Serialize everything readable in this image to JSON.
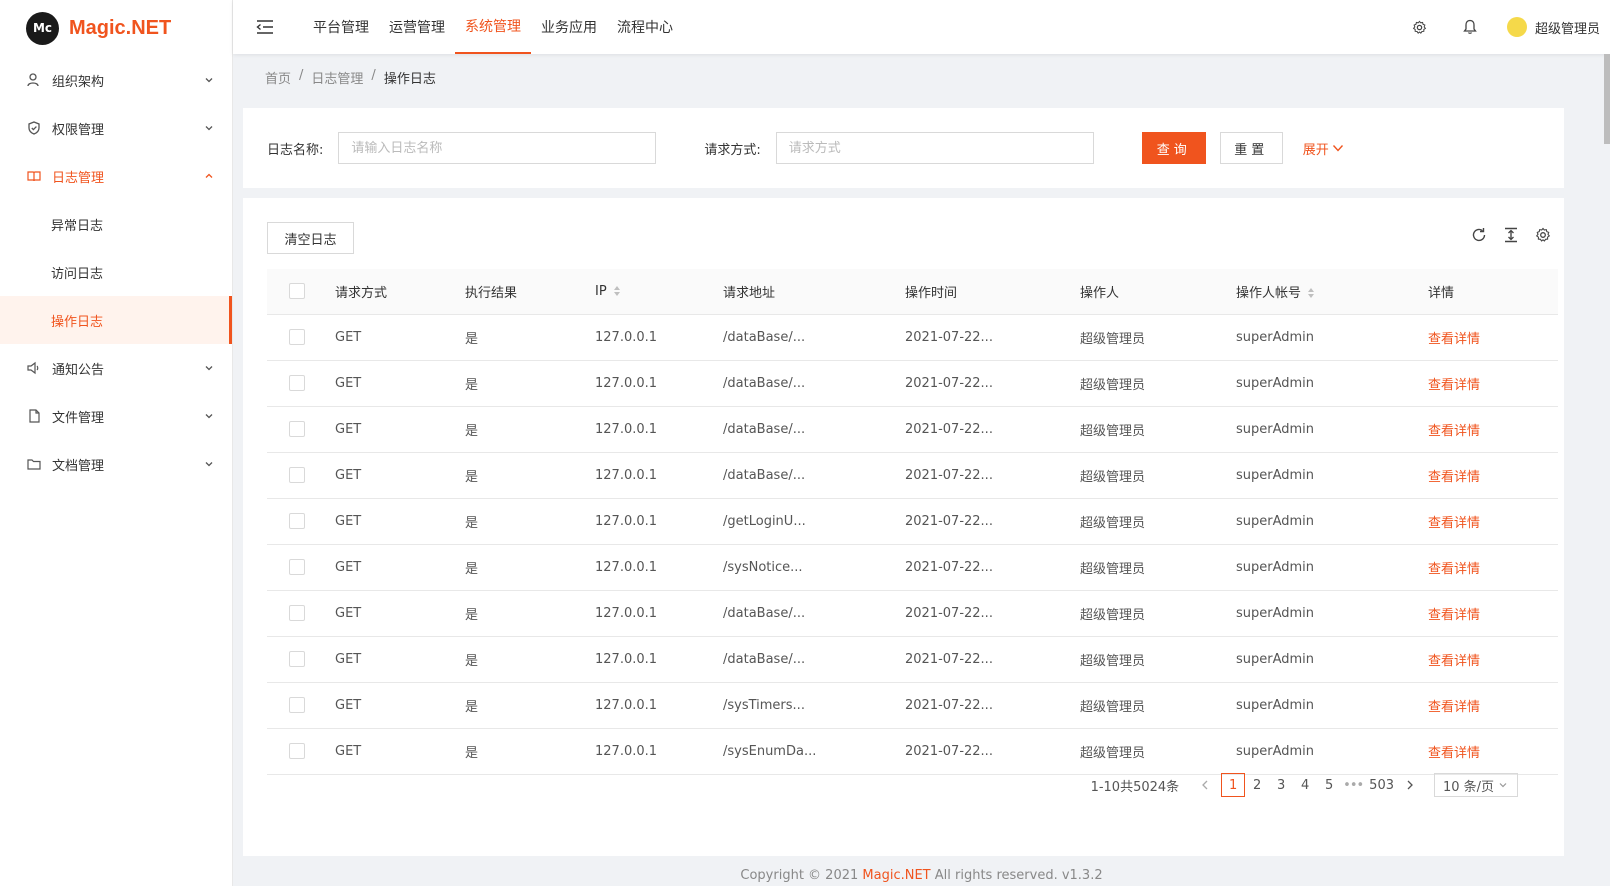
{
  "app": {
    "logo_mark": "Mc",
    "logo_text": "Magic.NET",
    "accent": "#f0541e"
  },
  "sidebar": {
    "items": [
      {
        "label": "组织架构",
        "icon": "org-icon"
      },
      {
        "label": "权限管理",
        "icon": "shield-icon"
      },
      {
        "label": "日志管理",
        "icon": "book-icon",
        "open": true,
        "children": [
          {
            "label": "异常日志"
          },
          {
            "label": "访问日志"
          },
          {
            "label": "操作日志",
            "active": true
          }
        ]
      },
      {
        "label": "通知公告",
        "icon": "speaker-icon"
      },
      {
        "label": "文件管理",
        "icon": "file-icon"
      },
      {
        "label": "文档管理",
        "icon": "folder-icon"
      }
    ]
  },
  "topbar": {
    "tabs": [
      {
        "label": "平台管理"
      },
      {
        "label": "运营管理"
      },
      {
        "label": "系统管理",
        "active": true
      },
      {
        "label": "业务应用"
      },
      {
        "label": "流程中心"
      }
    ],
    "user_name": "超级管理员"
  },
  "breadcrumb": {
    "items": [
      "首页",
      "日志管理",
      "操作日志"
    ],
    "separator": "/"
  },
  "search": {
    "name_label": "日志名称:",
    "name_placeholder": "请输入日志名称",
    "method_label": "请求方式:",
    "method_placeholder": "请求方式",
    "query_label": "查询",
    "reset_label": "重置",
    "expand_label": "展开"
  },
  "table": {
    "clear_label": "清空日志",
    "columns": [
      "请求方式",
      "执行结果",
      "IP",
      "请求地址",
      "操作时间",
      "操作人",
      "操作人帐号",
      "详情"
    ],
    "rows": [
      {
        "method": "GET",
        "result": "是",
        "ip": "127.0.0.1",
        "url": "/dataBase/...",
        "time": "2021-07-22...",
        "operator": "超级管理员",
        "account": "superAdmin",
        "detail": "查看详情"
      },
      {
        "method": "GET",
        "result": "是",
        "ip": "127.0.0.1",
        "url": "/dataBase/...",
        "time": "2021-07-22...",
        "operator": "超级管理员",
        "account": "superAdmin",
        "detail": "查看详情"
      },
      {
        "method": "GET",
        "result": "是",
        "ip": "127.0.0.1",
        "url": "/dataBase/...",
        "time": "2021-07-22...",
        "operator": "超级管理员",
        "account": "superAdmin",
        "detail": "查看详情"
      },
      {
        "method": "GET",
        "result": "是",
        "ip": "127.0.0.1",
        "url": "/dataBase/...",
        "time": "2021-07-22...",
        "operator": "超级管理员",
        "account": "superAdmin",
        "detail": "查看详情"
      },
      {
        "method": "GET",
        "result": "是",
        "ip": "127.0.0.1",
        "url": "/getLoginU...",
        "time": "2021-07-22...",
        "operator": "超级管理员",
        "account": "superAdmin",
        "detail": "查看详情"
      },
      {
        "method": "GET",
        "result": "是",
        "ip": "127.0.0.1",
        "url": "/sysNotice...",
        "time": "2021-07-22...",
        "operator": "超级管理员",
        "account": "superAdmin",
        "detail": "查看详情"
      },
      {
        "method": "GET",
        "result": "是",
        "ip": "127.0.0.1",
        "url": "/dataBase/...",
        "time": "2021-07-22...",
        "operator": "超级管理员",
        "account": "superAdmin",
        "detail": "查看详情"
      },
      {
        "method": "GET",
        "result": "是",
        "ip": "127.0.0.1",
        "url": "/dataBase/...",
        "time": "2021-07-22...",
        "operator": "超级管理员",
        "account": "superAdmin",
        "detail": "查看详情"
      },
      {
        "method": "GET",
        "result": "是",
        "ip": "127.0.0.1",
        "url": "/sysTimers...",
        "time": "2021-07-22...",
        "operator": "超级管理员",
        "account": "superAdmin",
        "detail": "查看详情"
      },
      {
        "method": "GET",
        "result": "是",
        "ip": "127.0.0.1",
        "url": "/sysEnumDa...",
        "time": "2021-07-22...",
        "operator": "超级管理员",
        "account": "superAdmin",
        "detail": "查看详情"
      }
    ]
  },
  "pagination": {
    "total_text": "1-10共5024条",
    "pages": [
      "1",
      "2",
      "3",
      "4",
      "5"
    ],
    "current": "1",
    "ellipsis": "•••",
    "last_page": "503",
    "page_size": "10 条/页"
  },
  "footer": {
    "prefix": "Copyright © 2021 ",
    "brand": "Magic.NET",
    "suffix": " All rights reserved. v1.3.2"
  }
}
